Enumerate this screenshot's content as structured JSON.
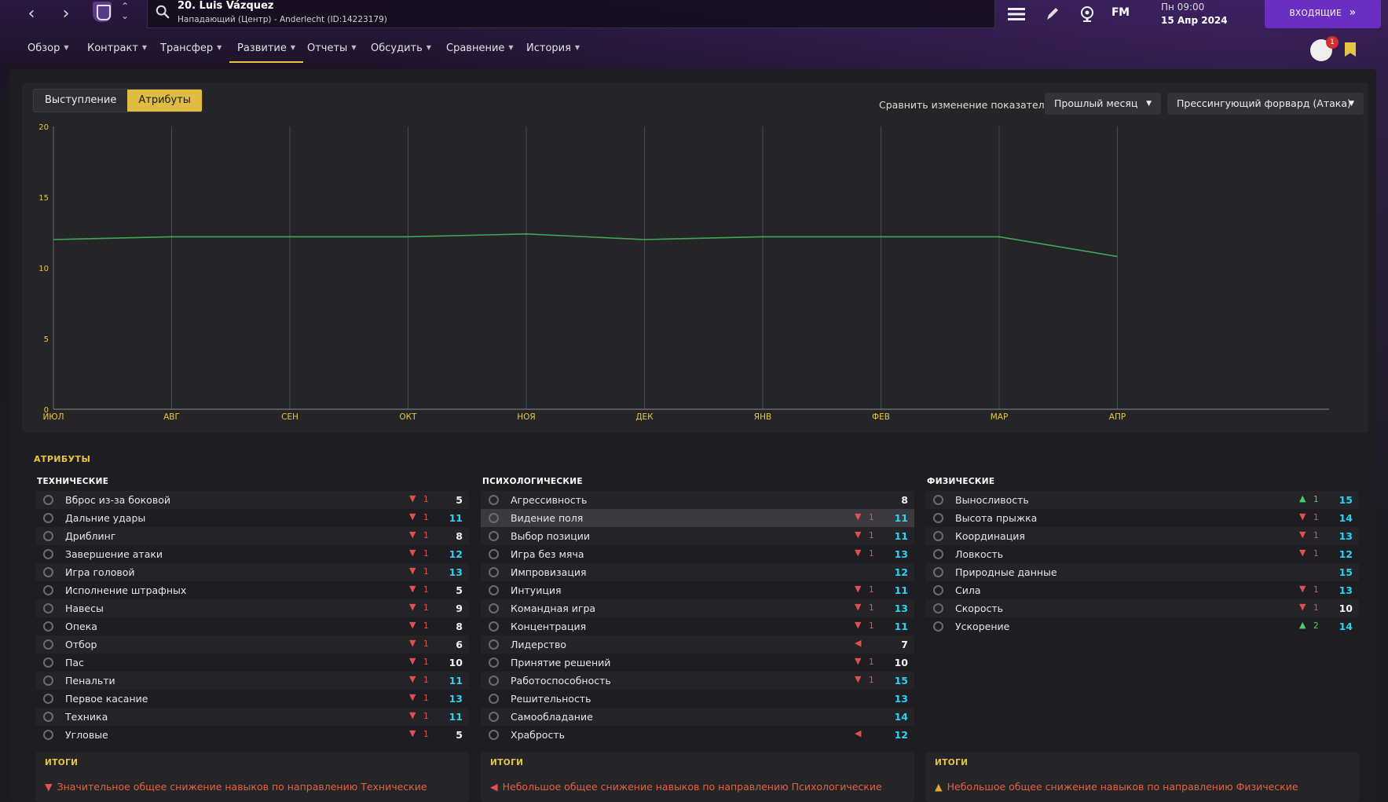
{
  "header": {
    "player_name": "20. Luis Vázquez",
    "player_sub": "Нападающий (Центр) - Anderlecht (ID:14223179)",
    "fm_logo": "FM",
    "time": "Пн 09:00",
    "date": "15 Апр 2024",
    "inbox_label": "ВХОДЯЩИЕ",
    "notification_count": "1"
  },
  "menu": [
    {
      "label": "Обзор",
      "active": false
    },
    {
      "label": "Контракт",
      "active": false
    },
    {
      "label": "Трансфер",
      "active": false
    },
    {
      "label": "Развитие",
      "active": true
    },
    {
      "label": "Отчеты",
      "active": false
    },
    {
      "label": "Обсудить",
      "active": false
    },
    {
      "label": "Сравнение",
      "active": false
    },
    {
      "label": "История",
      "active": false
    }
  ],
  "controls": {
    "tab_performance": "Выступление",
    "tab_attributes": "Атрибуты",
    "compare_label": "Сравнить изменение показателей",
    "period_select": "Прошлый месяц",
    "role_select": "Прессингующий форвард (Атака)"
  },
  "chart_data": {
    "type": "line",
    "categories": [
      "ИЮЛ",
      "АВГ",
      "СЕН",
      "ОКТ",
      "НОЯ",
      "ДЕК",
      "ЯНВ",
      "ФЕВ",
      "МАР",
      "АПР"
    ],
    "series": [
      {
        "values": [
          12.0,
          12.2,
          12.2,
          12.2,
          12.4,
          12.0,
          12.2,
          12.2,
          12.2,
          10.8
        ],
        "color": "#3fa85a"
      }
    ],
    "y_ticks": [
      "0",
      "5",
      "10",
      "15",
      "20"
    ],
    "ylim": [
      0,
      20
    ],
    "grid": "vertical"
  },
  "attributes_title": "АТРИБУТЫ",
  "columns": [
    {
      "title": "ТЕХНИЧЕСКИЕ",
      "items": [
        {
          "name": "Вброс из-за боковой",
          "dir": "down",
          "change": "1",
          "value": "5",
          "vc": "white"
        },
        {
          "name": "Дальние удары",
          "dir": "down",
          "change": "1",
          "value": "11",
          "vc": "cyan"
        },
        {
          "name": "Дриблинг",
          "dir": "down",
          "change": "1",
          "value": "8",
          "vc": "white"
        },
        {
          "name": "Завершение атаки",
          "dir": "down",
          "change": "1",
          "value": "12",
          "vc": "cyan"
        },
        {
          "name": "Игра головой",
          "dir": "down",
          "change": "1",
          "value": "13",
          "vc": "cyan"
        },
        {
          "name": "Исполнение штрафных",
          "dir": "down",
          "change": "1",
          "value": "5",
          "vc": "white"
        },
        {
          "name": "Навесы",
          "dir": "down",
          "change": "1",
          "value": "9",
          "vc": "white"
        },
        {
          "name": "Опека",
          "dir": "down",
          "change": "1",
          "value": "8",
          "vc": "white"
        },
        {
          "name": "Отбор",
          "dir": "down",
          "change": "1",
          "value": "6",
          "vc": "white"
        },
        {
          "name": "Пас",
          "dir": "down",
          "change": "1",
          "value": "10",
          "vc": "white"
        },
        {
          "name": "Пенальти",
          "dir": "down",
          "change": "1",
          "value": "11",
          "vc": "cyan"
        },
        {
          "name": "Первое касание",
          "dir": "down",
          "change": "1",
          "value": "13",
          "vc": "cyan"
        },
        {
          "name": "Техника",
          "dir": "down",
          "change": "1",
          "value": "11",
          "vc": "cyan"
        },
        {
          "name": "Угловые",
          "dir": "down",
          "change": "1",
          "value": "5",
          "vc": "white"
        }
      ],
      "summary_title": "ИТОГИ",
      "summary_text": "Значительное общее снижение навыков по направлению Технические",
      "summary_dir": "down"
    },
    {
      "title": "ПСИХОЛОГИЧЕСКИЕ",
      "items": [
        {
          "name": "Агрессивность",
          "dir": "",
          "change": "",
          "value": "8",
          "vc": "white"
        },
        {
          "name": "Видение поля",
          "dir": "down",
          "change": "1",
          "value": "11",
          "vc": "cyan",
          "hl": true
        },
        {
          "name": "Выбор позиции",
          "dir": "down",
          "change": "1",
          "value": "11",
          "vc": "cyan"
        },
        {
          "name": "Игра без мяча",
          "dir": "down",
          "change": "1",
          "value": "13",
          "vc": "cyan"
        },
        {
          "name": "Импровизация",
          "dir": "",
          "change": "",
          "value": "12",
          "vc": "cyan"
        },
        {
          "name": "Интуиция",
          "dir": "down",
          "change": "1",
          "value": "11",
          "vc": "cyan"
        },
        {
          "name": "Командная игра",
          "dir": "down",
          "change": "1",
          "value": "13",
          "vc": "cyan"
        },
        {
          "name": "Концентрация",
          "dir": "down",
          "change": "1",
          "value": "11",
          "vc": "cyan"
        },
        {
          "name": "Лидерство",
          "dir": "side",
          "change": "",
          "value": "7",
          "vc": "white"
        },
        {
          "name": "Принятие решений",
          "dir": "down",
          "change": "1",
          "value": "10",
          "vc": "white"
        },
        {
          "name": "Работоспособность",
          "dir": "down",
          "change": "1",
          "value": "15",
          "vc": "cyan"
        },
        {
          "name": "Решительность",
          "dir": "",
          "change": "",
          "value": "13",
          "vc": "cyan"
        },
        {
          "name": "Самообладание",
          "dir": "",
          "change": "",
          "value": "14",
          "vc": "cyan"
        },
        {
          "name": "Храбрость",
          "dir": "side",
          "change": "",
          "value": "12",
          "vc": "cyan"
        }
      ],
      "summary_title": "ИТОГИ",
      "summary_text": "Небольшое общее снижение навыков по направлению Психологические",
      "summary_dir": "side"
    },
    {
      "title": "ФИЗИЧЕСКИЕ",
      "items": [
        {
          "name": "Выносливость",
          "dir": "up",
          "change": "1",
          "value": "15",
          "vc": "cyan"
        },
        {
          "name": "Высота прыжка",
          "dir": "down",
          "change": "1",
          "value": "14",
          "vc": "cyan"
        },
        {
          "name": "Координация",
          "dir": "down",
          "change": "1",
          "value": "13",
          "vc": "cyan"
        },
        {
          "name": "Ловкость",
          "dir": "down",
          "change": "1",
          "value": "12",
          "vc": "cyan"
        },
        {
          "name": "Природные данные",
          "dir": "",
          "change": "",
          "value": "15",
          "vc": "cyan"
        },
        {
          "name": "Сила",
          "dir": "down",
          "change": "1",
          "value": "13",
          "vc": "cyan"
        },
        {
          "name": "Скорость",
          "dir": "down",
          "change": "1",
          "value": "10",
          "vc": "white"
        },
        {
          "name": "Ускорение",
          "dir": "up",
          "change": "2",
          "value": "14",
          "vc": "cyan"
        }
      ],
      "summary_title": "ИТОГИ",
      "summary_text": "Небольшое общее снижение навыков по направлению Физические",
      "summary_dir": "up-side"
    }
  ]
}
